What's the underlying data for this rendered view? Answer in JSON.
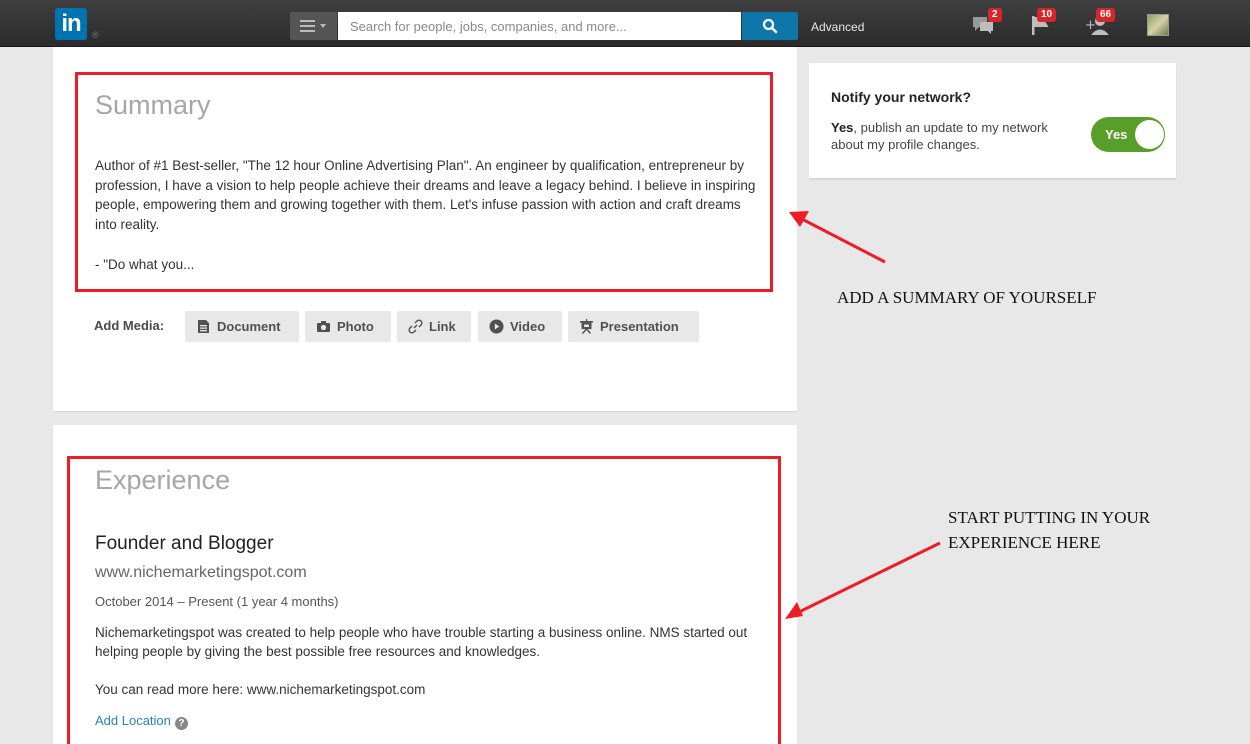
{
  "topbar": {
    "logo_text": "in",
    "logo_reg": "®",
    "search_placeholder": "Search for people, jobs, companies, and more...",
    "advanced_label": "Advanced",
    "messages_count": "2",
    "notifications_count": "10",
    "invitations_count": "66",
    "brand_color": "#0073b1"
  },
  "summary": {
    "title": "Summary",
    "text": "Author of #1 Best-seller, \"The 12 hour Online Advertising Plan\". An engineer by qualification, entrepreneur by profession, I have a vision to help people achieve their dreams and leave a legacy behind. I believe in inspiring people, empowering them and growing together with them. Let's infuse passion with action and craft dreams into reality.",
    "more": "- \"Do what you...",
    "add_media_label": "Add Media:",
    "media_buttons": {
      "document": "Document",
      "photo": "Photo",
      "link": "Link",
      "video": "Video",
      "presentation": "Presentation"
    }
  },
  "experience": {
    "title": "Experience",
    "job_title": "Founder and Blogger",
    "company": "www.nichemarketingspot.com",
    "dates": "October 2014 – Present (1 year 4 months)",
    "description": "Nichemarketingspot was created to help people who have trouble starting a business online. NMS started out helping people by giving the best possible free resources and knowledges.",
    "more": "You can read more here: www.nichemarketingspot.com",
    "add_location": "Add Location"
  },
  "notify": {
    "title": "Notify your network?",
    "yes_bold": "Yes",
    "text": ", publish an update to my network about my profile changes.",
    "toggle_label": "Yes",
    "toggle_color": "#5a9e2a"
  },
  "annotations": {
    "summary_note": "ADD A SUMMARY OF YOURSELF",
    "experience_note_line1": "START PUTTING IN YOUR",
    "experience_note_line2": "EXPERIENCE HERE",
    "highlight_color": "#ee1c24"
  }
}
